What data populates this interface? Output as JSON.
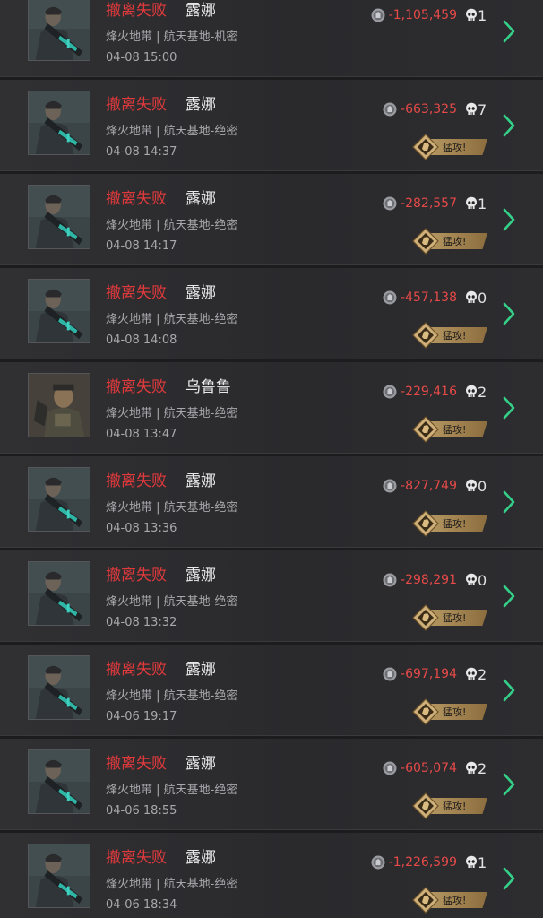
{
  "colors": {
    "fail": "#e0393c",
    "value": "#e64a48",
    "chevron": "#34d089",
    "badge": "#b89a64"
  },
  "icons": {
    "currency": "coin-icon",
    "kills": "skull-icon",
    "badge": "assault-emblem-icon",
    "chevron": "chevron-right-icon"
  },
  "records": [
    {
      "status": "撤离失败",
      "operator": "露娜",
      "map": "烽火地带 | 航天基地-机密",
      "time": "04-08 15:00",
      "value": "-1,105,459",
      "kills": "1",
      "badge": null
    },
    {
      "status": "撤离失败",
      "operator": "露娜",
      "map": "烽火地带 | 航天基地-绝密",
      "time": "04-08 14:37",
      "value": "-663,325",
      "kills": "7",
      "badge": "猛攻!"
    },
    {
      "status": "撤离失败",
      "operator": "露娜",
      "map": "烽火地带 | 航天基地-绝密",
      "time": "04-08 14:17",
      "value": "-282,557",
      "kills": "1",
      "badge": "猛攻!"
    },
    {
      "status": "撤离失败",
      "operator": "露娜",
      "map": "烽火地带 | 航天基地-绝密",
      "time": "04-08 14:08",
      "value": "-457,138",
      "kills": "0",
      "badge": "猛攻!"
    },
    {
      "status": "撤离失败",
      "operator": "乌鲁鲁",
      "map": "烽火地带 | 航天基地-绝密",
      "time": "04-08 13:47",
      "value": "-229,416",
      "kills": "2",
      "badge": "猛攻!"
    },
    {
      "status": "撤离失败",
      "operator": "露娜",
      "map": "烽火地带 | 航天基地-绝密",
      "time": "04-08 13:36",
      "value": "-827,749",
      "kills": "0",
      "badge": "猛攻!"
    },
    {
      "status": "撤离失败",
      "operator": "露娜",
      "map": "烽火地带 | 航天基地-绝密",
      "time": "04-08 13:32",
      "value": "-298,291",
      "kills": "0",
      "badge": "猛攻!"
    },
    {
      "status": "撤离失败",
      "operator": "露娜",
      "map": "烽火地带 | 航天基地-绝密",
      "time": "04-06 19:17",
      "value": "-697,194",
      "kills": "2",
      "badge": "猛攻!"
    },
    {
      "status": "撤离失败",
      "operator": "露娜",
      "map": "烽火地带 | 航天基地-绝密",
      "time": "04-06 18:55",
      "value": "-605,074",
      "kills": "2",
      "badge": "猛攻!"
    },
    {
      "status": "撤离失败",
      "operator": "露娜",
      "map": "烽火地带 | 航天基地-绝密",
      "time": "04-06 18:34",
      "value": "-1,226,599",
      "kills": "1",
      "badge": "猛攻!"
    }
  ]
}
